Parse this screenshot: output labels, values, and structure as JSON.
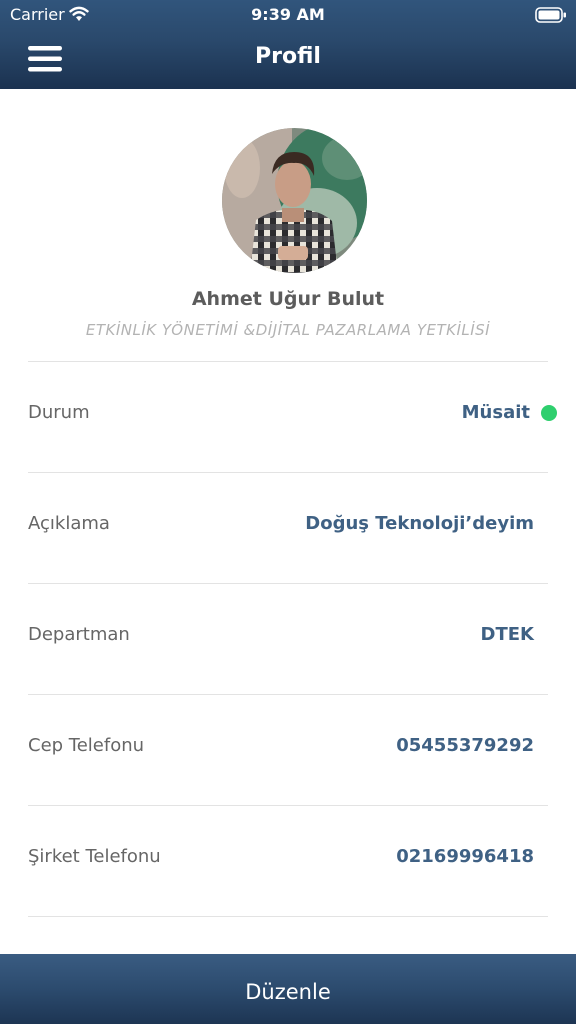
{
  "status_bar": {
    "carrier": "Carrier",
    "time": "9:39 AM",
    "wifi_icon": "wifi-icon",
    "battery_icon": "battery-icon"
  },
  "header": {
    "menu_icon": "hamburger-menu-icon",
    "title": "Profil"
  },
  "profile": {
    "name": "Ahmet Uğur Bulut",
    "job_title": "ETKİNLİK YÖNETİMİ &DİJİTAL PAZARLAMA YETKİLİSİ"
  },
  "details": [
    {
      "label": "Durum",
      "value": "Müsait"
    },
    {
      "label": "Açıklama",
      "value": "Doğuş Teknoloji’deyim"
    },
    {
      "label": "Departman",
      "value": "DTEK"
    },
    {
      "label": "Cep Telefonu",
      "value": "05455379292"
    },
    {
      "label": "Şirket Telefonu",
      "value": "02169996418"
    }
  ],
  "status_color": "#2fcf6e",
  "footer": {
    "edit_label": "Düzenle"
  }
}
